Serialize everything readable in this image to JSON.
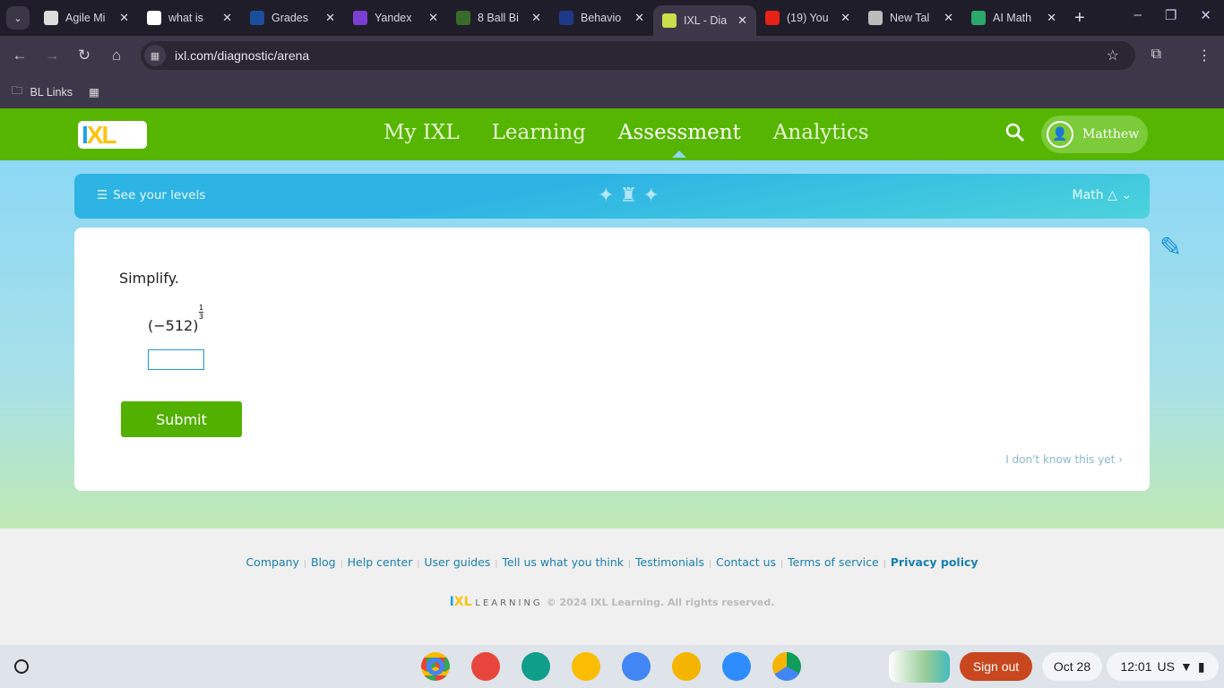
{
  "browser": {
    "tabs": [
      {
        "title": "Agile Mi",
        "favicon": "agile-mind-icon",
        "color": "#ddd"
      },
      {
        "title": "what is",
        "favicon": "google-icon",
        "color": "#fff"
      },
      {
        "title": "Grades",
        "favicon": "sis-icon",
        "color": "#1b4f9c"
      },
      {
        "title": "Yandex",
        "favicon": "gamepad-icon",
        "color": "#7a3fd0"
      },
      {
        "title": "8 Ball Bi",
        "favicon": "billiards-icon",
        "color": "#3a6a2a"
      },
      {
        "title": "Behavio",
        "favicon": "behavior-icon",
        "color": "#1d3a8a"
      },
      {
        "title": "IXL - Dia",
        "favicon": "ixl-icon",
        "color": "#c8e04a",
        "active": true
      },
      {
        "title": "(19) You",
        "favicon": "youtube-icon",
        "color": "#e62117"
      },
      {
        "title": "New Tal",
        "favicon": "chrome-icon",
        "color": "#bbb"
      },
      {
        "title": "AI Math",
        "favicon": "compass-icon",
        "color": "#2aa86a"
      }
    ],
    "url": "ixl.com/diagnostic/arena",
    "bookmarks": {
      "folder": "BL Links"
    }
  },
  "header": {
    "logo": "IXL",
    "nav": [
      "My IXL",
      "Learning",
      "Assessment",
      "Analytics"
    ],
    "active_nav": "Assessment",
    "user": "Matthew"
  },
  "banner": {
    "levels": "See your levels",
    "subject": "Math"
  },
  "question": {
    "prompt": "Simplify.",
    "base": "(−512)",
    "exp_num": "1",
    "exp_den": "3",
    "answer_value": "",
    "submit": "Submit",
    "skip": "I don't know this yet ›"
  },
  "footer": {
    "links": [
      "Company",
      "Blog",
      "Help center",
      "User guides",
      "Tell us what you think",
      "Testimonials",
      "Contact us",
      "Terms of service",
      "Privacy policy"
    ],
    "logo_word": "LEARNING",
    "copyright": "© 2024 IXL Learning. All rights reserved."
  },
  "shelf": {
    "signout": "Sign out",
    "date": "Oct 28",
    "time": "12:01",
    "locale": "US"
  },
  "colors": {
    "brand_green": "#56b500",
    "submit_green": "#52b000",
    "sky": "#8cd8f5"
  }
}
